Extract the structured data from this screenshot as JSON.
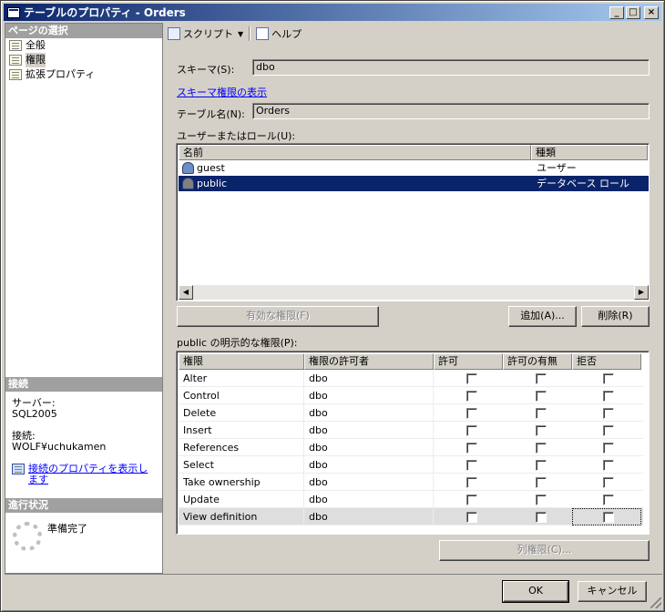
{
  "window": {
    "title": "テーブルのプロパティ - Orders",
    "minimize": "_",
    "maximize": "□",
    "close": "×"
  },
  "left": {
    "select_page_header": "ページの選択",
    "pages": [
      {
        "label": "全般",
        "selected": false
      },
      {
        "label": "権限",
        "selected": true
      },
      {
        "label": "拡張プロパティ",
        "selected": false
      }
    ],
    "connection_header": "接続",
    "server_label": "サーバー:",
    "server_value": "SQL2005",
    "connection_label": "接続:",
    "connection_value": "WOLF¥uchukamen",
    "connection_link": "接続のプロパティを表示します",
    "progress_header": "進行状況",
    "progress_status": "準備完了"
  },
  "toolbar": {
    "script_label": "スクリプト",
    "help_label": "ヘルプ"
  },
  "main": {
    "schema_label": "スキーマ(S):",
    "schema_value": "dbo",
    "schema_perm_link": "スキーマ権限の表示",
    "table_label": "テーブル名(N):",
    "table_value": "Orders",
    "users_label": "ユーザーまたはロール(U):",
    "users_columns": [
      "名前",
      "種類"
    ],
    "users": [
      {
        "name": "guest",
        "type": "ユーザー",
        "selected": false
      },
      {
        "name": "public",
        "type": "データベース ロール",
        "selected": true
      }
    ],
    "effective_perm_button": "有効な権限(F)",
    "add_button": "追加(A)...",
    "remove_button": "削除(R)",
    "explicit_label": "public の明示的な権限(P):",
    "perm_columns": [
      "権限",
      "権限の許可者",
      "許可",
      "許可の有無",
      "拒否"
    ],
    "permissions": [
      {
        "name": "Alter",
        "grantor": "dbo"
      },
      {
        "name": "Control",
        "grantor": "dbo"
      },
      {
        "name": "Delete",
        "grantor": "dbo"
      },
      {
        "name": "Insert",
        "grantor": "dbo"
      },
      {
        "name": "References",
        "grantor": "dbo"
      },
      {
        "name": "Select",
        "grantor": "dbo"
      },
      {
        "name": "Take ownership",
        "grantor": "dbo"
      },
      {
        "name": "Update",
        "grantor": "dbo"
      },
      {
        "name": "View definition",
        "grantor": "dbo"
      }
    ],
    "column_perm_button": "列権限(C)..."
  },
  "footer": {
    "ok_button": "OK",
    "cancel_button": "キャンセル"
  },
  "colors": {
    "titlebar": "#0a246a",
    "selection": "#0a246a",
    "link": "#0000ff",
    "face": "#d4d0c8"
  }
}
